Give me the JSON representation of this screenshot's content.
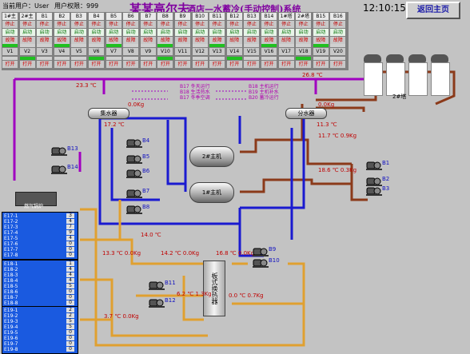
{
  "header": {
    "user_label": "当前用户：User",
    "permission_label": "用户权限：999",
    "title_main": "某某高尔夫",
    "title_sub": "酒店—水蓄冷(手动控制)系统",
    "time": "12:10:15",
    "back_button": "返回主页"
  },
  "grid": {
    "columns": [
      "1#主机",
      "2#主机",
      "B1",
      "B2",
      "B3",
      "B4",
      "B5",
      "B6",
      "B7",
      "B8",
      "B9",
      "B10",
      "B11",
      "B12",
      "B13",
      "B14",
      "1#塔",
      "2#塔",
      "B15",
      "B16"
    ],
    "states": [
      "停止",
      "停止",
      "停止",
      "停止",
      "停止",
      "停止",
      "停止",
      "停止",
      "停止",
      "停止",
      "停止",
      "停止",
      "停止",
      "停止",
      "停止",
      "停止",
      "停止",
      "停止",
      "停止",
      "停止"
    ],
    "start_label": "启动",
    "fault_label": "故障",
    "valve_labels": [
      "V1",
      "V2",
      "V3",
      "V4",
      "V5",
      "V6",
      "V7",
      "V8",
      "V9",
      "V10",
      "V11",
      "V12",
      "V13",
      "V14",
      "V15",
      "V16",
      "V17",
      "V18",
      "V19",
      "V20"
    ],
    "open_label": "打开"
  },
  "equipment": {
    "chiller1": "1#主机",
    "chiller2": "2#主机",
    "collector": "集水器",
    "distributor": "分水器",
    "hex": "板式换热器",
    "tower": "2#塔",
    "boiler": "燃气锅炉"
  },
  "notes": [
    "B17 冬天运行",
    "B18 生活热水",
    "B17 冬季空调",
    "B18 主机运行",
    "B19 主机补水",
    "B20 蓄冷运行"
  ],
  "readings": [
    {
      "id": "T12",
      "text": "26.8 ℃"
    },
    {
      "id": "T11",
      "text": "23.3 ℃"
    },
    {
      "id": "P5",
      "text": "0.0Kg"
    },
    {
      "id": "P6",
      "text": "0.0Kg"
    },
    {
      "id": "T13",
      "text": "17.2 ℃"
    },
    {
      "id": "T10",
      "text": "11.3 ℃"
    },
    {
      "id": "P8",
      "text": "11.7 ℃  0.9Kg"
    },
    {
      "id": "T11b",
      "text": "18.6 ℃  0.3Kg"
    },
    {
      "id": "T8",
      "text": "14.0 ℃"
    },
    {
      "id": "T9",
      "text": "13.3 ℃  0.0Kg"
    },
    {
      "id": "T3",
      "text": "14.2 ℃  0.0Kg"
    },
    {
      "id": "T4",
      "text": "16.8 ℃  0.0Kg"
    },
    {
      "id": "T6",
      "text": "6.2 ℃  1.3Kg"
    },
    {
      "id": "T5",
      "text": "0.0 ℃  0.7Kg"
    },
    {
      "id": "T7",
      "text": "3.7 ℃  0.0Kg"
    }
  ],
  "panels": [
    {
      "rows": [
        "E17-1",
        "E17-2",
        "E17-3",
        "E17-4",
        "E17-5",
        "E17-6",
        "E17-7",
        "E17-8"
      ],
      "vals": [
        "3",
        "4",
        "7",
        "9",
        "4",
        "0",
        "0",
        "0"
      ]
    },
    {
      "rows": [
        "E18-1",
        "E18-2",
        "E18-3",
        "E18-4",
        "E18-5",
        "E18-6",
        "E18-7",
        "E18-8"
      ],
      "vals": [
        "1",
        "4",
        "4",
        "4",
        "5",
        "0",
        "0",
        "0"
      ]
    },
    {
      "rows": [
        "E19-1",
        "E19-2",
        "E19-3",
        "E19-4",
        "E19-5",
        "E19-6",
        "E19-7",
        "E19-8"
      ],
      "vals": [
        "2",
        "2",
        "5",
        "5",
        "0",
        "0",
        "0",
        "0"
      ]
    }
  ],
  "pumps": [
    "B1",
    "B2",
    "B3",
    "B4",
    "B5",
    "B6",
    "B7",
    "B8",
    "B9",
    "B10",
    "B11",
    "B12",
    "B13",
    "B14"
  ],
  "valves": [
    "V1",
    "V2",
    "V3",
    "V4",
    "V5",
    "V6",
    "V7",
    "V8",
    "V9",
    "V10",
    "V11",
    "V12",
    "V13",
    "V14",
    "V15",
    "V16"
  ],
  "colors": {
    "bg": "#c3c3c3",
    "title": "#8000a0",
    "stop": "#c00000",
    "start": "#007000",
    "pipe_blue": "#1a1ad0",
    "pipe_brown": "#8b3a1a",
    "pipe_orange": "#e0a030",
    "pipe_magenta": "#a000c0"
  }
}
